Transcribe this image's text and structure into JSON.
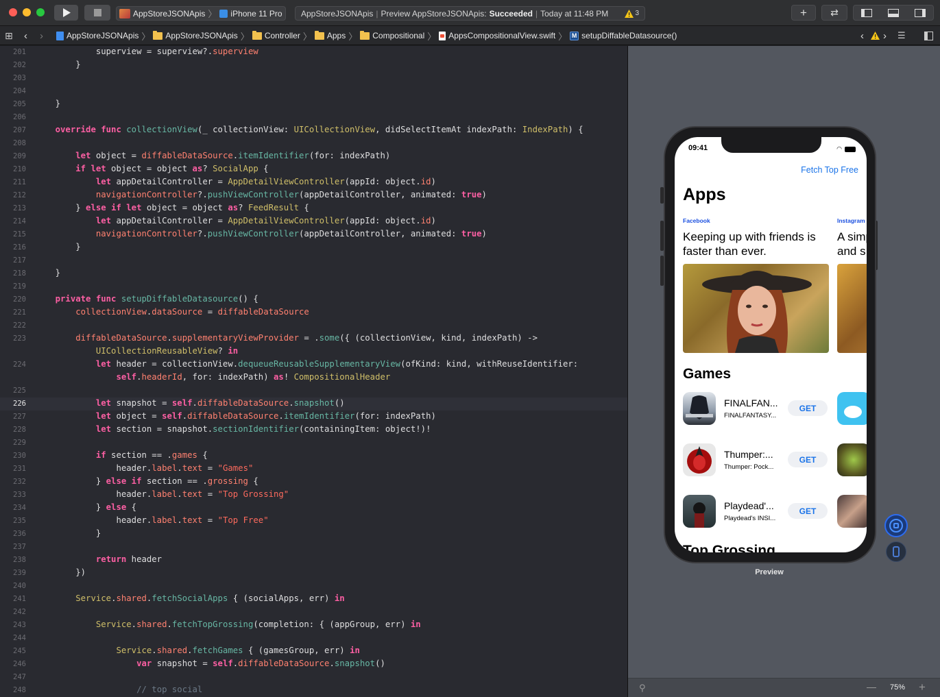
{
  "toolbar": {
    "scheme": "AppStoreJSONApis",
    "device": "iPhone 11 Pro",
    "activity_project": "AppStoreJSONApis",
    "activity_action": "Preview AppStoreJSONApis:",
    "activity_status": "Succeeded",
    "activity_time": "Today at 11:48 PM",
    "warning_count": "3"
  },
  "breadcrumb": [
    "AppStoreJSONApis",
    "AppStoreJSONApis",
    "Controller",
    "Apps",
    "Compositional",
    "AppsCompositionalView.swift",
    "setupDiffableDatasource()"
  ],
  "editor": {
    "current_line": "226",
    "lines": [
      {
        "n": "201",
        "html": "            superview = superview?.<span class='p'>superview</span>"
      },
      {
        "n": "202",
        "html": "        }"
      },
      {
        "n": "203",
        "html": ""
      },
      {
        "n": "204",
        "html": ""
      },
      {
        "n": "205",
        "html": "    }"
      },
      {
        "n": "206",
        "html": ""
      },
      {
        "n": "207",
        "html": "    <span class='k'>override func</span> <span class='f'>collectionView</span>(_ collectionView: <span class='t'>UICollectionView</span>, didSelectItemAt indexPath: <span class='t'>IndexPath</span>) {"
      },
      {
        "n": "208",
        "html": ""
      },
      {
        "n": "209",
        "html": "        <span class='k'>let</span> object = <span class='p'>diffableDataSource</span>.<span class='f'>itemIdentifier</span>(for: indexPath)"
      },
      {
        "n": "210",
        "html": "        <span class='k'>if let</span> object = object <span class='k'>as</span>? <span class='t'>SocialApp</span> {"
      },
      {
        "n": "211",
        "html": "            <span class='k'>let</span> appDetailController = <span class='t'>AppDetailViewController</span>(appId: object.<span class='p'>id</span>)"
      },
      {
        "n": "212",
        "html": "            <span class='p'>navigationController</span>?.<span class='f'>pushViewController</span>(appDetailController, animated: <span class='k'>true</span>)"
      },
      {
        "n": "213",
        "html": "        } <span class='k'>else if let</span> object = object <span class='k'>as</span>? <span class='t'>FeedResult</span> {"
      },
      {
        "n": "214",
        "html": "            <span class='k'>let</span> appDetailController = <span class='t'>AppDetailViewController</span>(appId: object.<span class='p'>id</span>)"
      },
      {
        "n": "215",
        "html": "            <span class='p'>navigationController</span>?.<span class='f'>pushViewController</span>(appDetailController, animated: <span class='k'>true</span>)"
      },
      {
        "n": "216",
        "html": "        }"
      },
      {
        "n": "217",
        "html": ""
      },
      {
        "n": "218",
        "html": "    }"
      },
      {
        "n": "219",
        "html": ""
      },
      {
        "n": "220",
        "html": "    <span class='k'>private func</span> <span class='f'>setupDiffableDatasource</span>() {"
      },
      {
        "n": "221",
        "html": "        <span class='p'>collectionView</span>.<span class='p'>dataSource</span> = <span class='p'>diffableDataSource</span>"
      },
      {
        "n": "222",
        "html": ""
      },
      {
        "n": "223",
        "html": "        <span class='p'>diffableDataSource</span>.<span class='p'>supplementaryViewProvider</span> = .<span class='f'>some</span>({ (collectionView, kind, indexPath) -&gt;"
      },
      {
        "n": "",
        "html": "            <span class='t'>UICollectionReusableView</span>? <span class='k'>in</span>"
      },
      {
        "n": "224",
        "html": "            <span class='k'>let</span> header = collectionView.<span class='f'>dequeueReusableSupplementaryView</span>(ofKind: kind, withReuseIdentifier:"
      },
      {
        "n": "",
        "html": "                <span class='k'>self</span>.<span class='p'>headerId</span>, for: indexPath) <span class='k'>as</span>! <span class='t'>CompositionalHeader</span>"
      },
      {
        "n": "225",
        "html": ""
      },
      {
        "n": "226",
        "html": "            <span class='k'>let</span> snapshot = <span class='k'>self</span>.<span class='p'>diffableDataSource</span>.<span class='f'>snapshot</span>()"
      },
      {
        "n": "227",
        "html": "            <span class='k'>let</span> object = <span class='k'>self</span>.<span class='p'>diffableDataSource</span>.<span class='f'>itemIdentifier</span>(for: indexPath)"
      },
      {
        "n": "228",
        "html": "            <span class='k'>let</span> section = snapshot.<span class='f'>sectionIdentifier</span>(containingItem: object!)!"
      },
      {
        "n": "229",
        "html": ""
      },
      {
        "n": "230",
        "html": "            <span class='k'>if</span> section == .<span class='p'>games</span> {"
      },
      {
        "n": "231",
        "html": "                header.<span class='p'>label</span>.<span class='p'>text</span> = <span class='s'>\"Games\"</span>"
      },
      {
        "n": "232",
        "html": "            } <span class='k'>else if</span> section == .<span class='p'>grossing</span> {"
      },
      {
        "n": "233",
        "html": "                header.<span class='p'>label</span>.<span class='p'>text</span> = <span class='s'>\"Top Grossing\"</span>"
      },
      {
        "n": "234",
        "html": "            } <span class='k'>else</span> {"
      },
      {
        "n": "235",
        "html": "                header.<span class='p'>label</span>.<span class='p'>text</span> = <span class='s'>\"Top Free\"</span>"
      },
      {
        "n": "236",
        "html": "            }"
      },
      {
        "n": "237",
        "html": ""
      },
      {
        "n": "238",
        "html": "            <span class='k'>return</span> header"
      },
      {
        "n": "239",
        "html": "        })"
      },
      {
        "n": "240",
        "html": ""
      },
      {
        "n": "241",
        "html": "        <span class='t'>Service</span>.<span class='p'>shared</span>.<span class='f'>fetchSocialApps</span> { (socialApps, err) <span class='k'>in</span>"
      },
      {
        "n": "242",
        "html": ""
      },
      {
        "n": "243",
        "html": "            <span class='t'>Service</span>.<span class='p'>shared</span>.<span class='f'>fetchTopGrossing</span>(completion: { (appGroup, err) <span class='k'>in</span>"
      },
      {
        "n": "244",
        "html": ""
      },
      {
        "n": "245",
        "html": "                <span class='t'>Service</span>.<span class='p'>shared</span>.<span class='f'>fetchGames</span> { (gamesGroup, err) <span class='k'>in</span>"
      },
      {
        "n": "246",
        "html": "                    <span class='k'>var</span> snapshot = <span class='k'>self</span>.<span class='p'>diffableDataSource</span>.<span class='f'>snapshot</span>()"
      },
      {
        "n": "247",
        "html": ""
      },
      {
        "n": "248",
        "html": "                    <span class='c'>// top social</span>"
      }
    ]
  },
  "preview": {
    "label": "Preview",
    "zoom": "75%",
    "phone": {
      "time": "09:41",
      "nav_button": "Fetch Top Free",
      "large_title": "Apps",
      "social": [
        {
          "company": "Facebook",
          "tagline": "Keeping up with friends is faster than ever."
        },
        {
          "company": "Instagram",
          "tagline": "A simple and s"
        }
      ],
      "section_games": "Games",
      "section_next": "Top Grossing",
      "games": [
        {
          "name": "FINALFAN...",
          "sub": "FINALFANTASY...",
          "get": "GET"
        },
        {
          "name": "Thumper:...",
          "sub": "Thumper: Pock...",
          "get": "GET"
        },
        {
          "name": "Playdead'...",
          "sub": "Playdead's INSI...",
          "get": "GET"
        }
      ]
    }
  },
  "colors": {
    "keyword": "#fc5fa3",
    "function": "#67b7a4",
    "property": "#ff8170",
    "type": "#d0bf69",
    "string": "#fc6a5d",
    "link": "#1a73e8",
    "warning": "#f5c518"
  }
}
